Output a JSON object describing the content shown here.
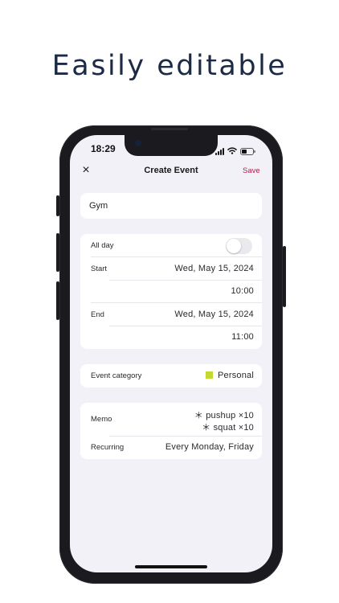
{
  "headline": "Easily editable",
  "status_bar": {
    "time": "18:29",
    "icons": [
      "cellular-signal-icon",
      "wifi-icon",
      "battery-icon"
    ]
  },
  "nav": {
    "close_icon": "×",
    "title": "Create Event",
    "save_label": "Save"
  },
  "event": {
    "title_value": "Gym"
  },
  "schedule": {
    "all_day_label": "All day",
    "all_day_on": false,
    "start_label": "Start",
    "start_date": "Wed, May 15, 2024",
    "start_time": "10:00",
    "end_label": "End",
    "end_date": "Wed, May 15, 2024",
    "end_time": "11:00"
  },
  "category": {
    "label": "Event category",
    "value": "Personal",
    "color": "#c5d832"
  },
  "details": {
    "memo_label": "Memo",
    "memo_lines": [
      "＊ pushup ×10",
      "＊ squat ×10"
    ],
    "recurring_label": "Recurring",
    "recurring_value": "Every Monday, Friday"
  },
  "colors": {
    "accent_save": "#b02046",
    "background": "#f2f1f7",
    "headline": "#1c2a45"
  }
}
